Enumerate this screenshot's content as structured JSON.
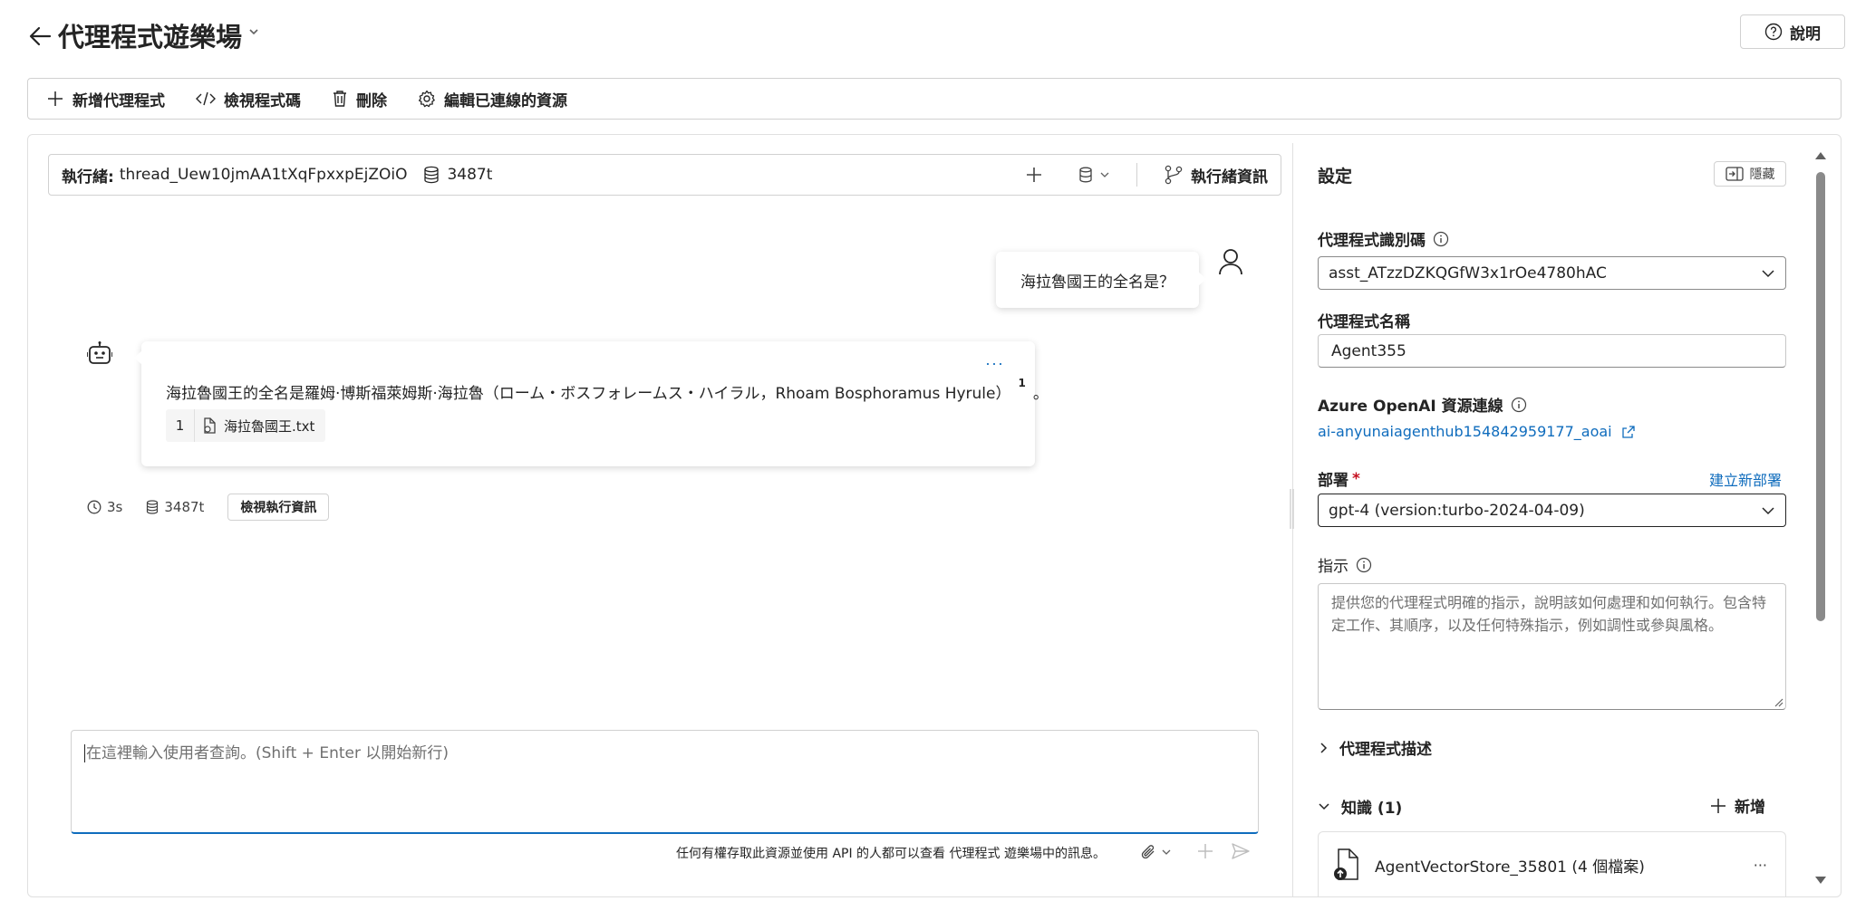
{
  "header": {
    "title": "代理程式遊樂場",
    "help_label": "說明"
  },
  "toolbar": {
    "new_agent": "新增代理程式",
    "view_code": "檢視程式碼",
    "delete": "刪除",
    "edit_resources": "編輯已連線的資源"
  },
  "thread": {
    "label": "執行緒:",
    "id": "thread_Uew10jmAA1tXqFpxxpEjZOiO",
    "tokens": "3487t",
    "info_label": "執行緒資訊"
  },
  "chat": {
    "user_message": "海拉魯國王的全名是？",
    "bot_message": "海拉魯國王的全名是羅姆·博斯福萊姆斯·海拉魯（ローム・ボスフォレームス・ハイラル，Rhoam Bosphoramus Hyrule）",
    "bot_cite_sup": "1",
    "bot_message_end": "。",
    "more": "···",
    "citation": {
      "number": "1",
      "file": "海拉魯國王.txt"
    },
    "meta": {
      "time": "3s",
      "tokens": "3487t",
      "run_info": "檢視執行資訊"
    },
    "input_placeholder": "在這裡輸入使用者查詢。(Shift + Enter 以開始新行)",
    "disclaimer": "任何有權存取此資源並使用 API 的人都可以查看 代理程式 遊樂場中的訊息。"
  },
  "settings": {
    "title": "設定",
    "hide": "隱藏",
    "agent_id_label": "代理程式識別碼",
    "agent_id": "asst_ATzzDZKQGfW3x1rOe4780hAC",
    "agent_name_label": "代理程式名稱",
    "agent_name": "Agent355",
    "aoai_label": "Azure OpenAI 資源連線",
    "aoai_link": "ai-anyunaiagenthub154842959177_aoai",
    "deploy_label": "部署",
    "required_mark": "*",
    "new_deploy": "建立新部署",
    "deploy_value": "gpt-4 (version:turbo-2024-04-09)",
    "instructions_label": "指示",
    "instructions_placeholder": "提供您的代理程式明確的指示，說明該如何處理和如何執行。包含特定工作、其順序，以及任何特殊指示，例如調性或參與風格。",
    "description_label": "代理程式描述",
    "knowledge_label": "知識 (1)",
    "add_label": "新增",
    "vector_store": "AgentVectorStore_35801 (4 個檔案)",
    "more": "···"
  },
  "colors": {
    "accent": "#0f6cbd",
    "text": "#242424",
    "border": "#d1d1d1",
    "required": "#c50f1f"
  }
}
